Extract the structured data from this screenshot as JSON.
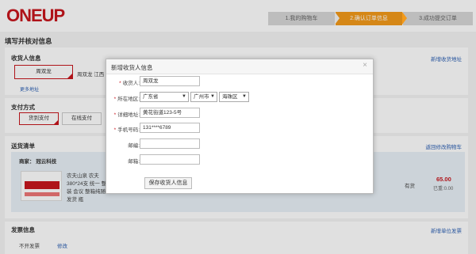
{
  "header": {
    "logo": "ONEUP",
    "steps": [
      "1.我的购物车",
      "2.确认订单信息",
      "3.成功提交订单"
    ]
  },
  "page": {
    "title": "填写并核对信息",
    "receiver": {
      "heading": "收货人信息",
      "new_address_link": "新增收货地址",
      "selected_name": "周双龙",
      "address_text": "周双龙   江西",
      "more_link": "更多地址"
    },
    "payment": {
      "heading": "支付方式",
      "options": [
        "货到支付",
        "在线支付"
      ]
    },
    "shipping": {
      "heading": "送货清单",
      "back_link": "返回修改购物车",
      "shop_label": "商家：  冠云科技",
      "product_name": "农夫山泉 农夫380*24支 统一 整箱装 会议 整箱纯随机发货 瓶",
      "stock": "有货",
      "price": "65.00",
      "weight": "0.00"
    },
    "invoice": {
      "heading": "发票信息",
      "edit_title_link": "新增单位发票",
      "value": "不开发票",
      "edit_link": "修改"
    }
  },
  "modal": {
    "title": "新增收货人信息",
    "close": "×",
    "receiver_label": "收货人:",
    "receiver_value": "周双龙",
    "region_label": "所在地区:",
    "province": "广东省",
    "city": "广州市",
    "district": "海珠区",
    "address_label": "详细地址:",
    "address_value": "黄花街道123-5号",
    "phone_label": "手机号码:",
    "phone_value": "131****6789",
    "postcode_label": "邮编:",
    "email_label": "邮箱:",
    "save_label": "保存收货人信息"
  },
  "colors": {
    "brand_red": "#c8161d",
    "active_step": "#f39a1b",
    "link_blue": "#2b5fb3"
  }
}
